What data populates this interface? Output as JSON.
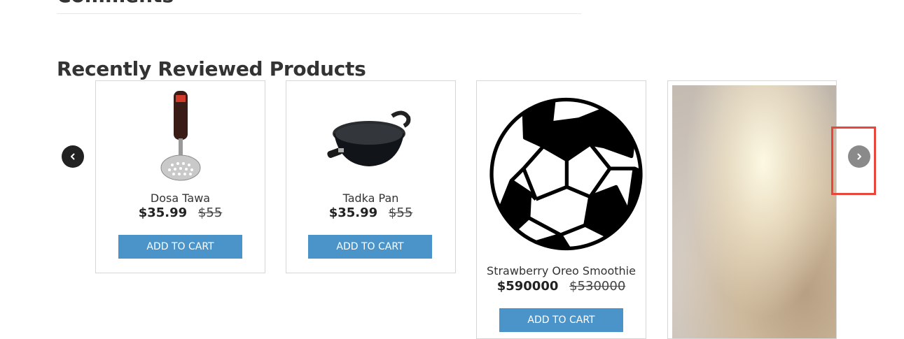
{
  "comments": {
    "title": "Comments"
  },
  "section": {
    "title": "Recently Reviewed Products"
  },
  "products": [
    {
      "name": "Dosa Tawa",
      "price": "$35.99",
      "old_price": "$55",
      "button": "ADD TO CART",
      "image": "potato-masher"
    },
    {
      "name": "Tadka Pan",
      "price": "$35.99",
      "old_price": "$55",
      "button": "ADD TO CART",
      "image": "kadai-pan"
    },
    {
      "name": "Strawberry Oreo Smoothie",
      "price": "$590000",
      "old_price": "$530000",
      "button": "ADD TO CART",
      "image": "soccer-ball"
    },
    {
      "image": "textured-photo"
    }
  ],
  "carousel": {
    "prev_icon": "chevron-left-icon",
    "next_icon": "chevron-right-icon"
  },
  "colors": {
    "button": "#4a94c9",
    "highlight": "#e8463b",
    "prev_bg": "#222222",
    "next_bg": "#8a8a8a"
  }
}
